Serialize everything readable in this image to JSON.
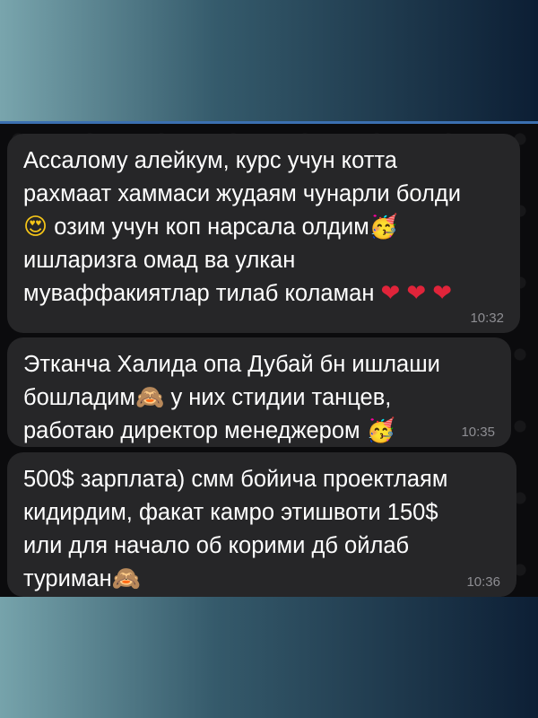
{
  "messages": [
    {
      "lines": [
        "Ассалому алейкум, курс учун котта",
        "рахмаат хаммаси жудаям чунарли болди",
        "озим учун коп нарсала олдим",
        "ишларизга омад ва улкан",
        "муваффакиятлар тилаб коламан"
      ],
      "time": "10:32"
    },
    {
      "lines": [
        "Этканча Халида опа Дубай бн ишлаши",
        "бошладим",
        "у них стидии танцев,",
        "работаю директор менеджером"
      ],
      "time": "10:35"
    },
    {
      "lines": [
        "500$ зарплата) смм бойича проектлаям",
        "кидирдим, факат камро этишвоти 150$",
        "или для начало об корими дб ойлаб",
        "туриман"
      ],
      "time": "10:36"
    }
  ],
  "icons": {
    "heart_eyes": "😍",
    "party_face": "🥳",
    "heart": "❤",
    "see_no_evil_monkey": "🙈"
  },
  "colors": {
    "bubble": "#262628",
    "chat_bg": "#0b0b0d",
    "timestamp": "#8e8e93",
    "accent_line": "#3b6fb0"
  }
}
